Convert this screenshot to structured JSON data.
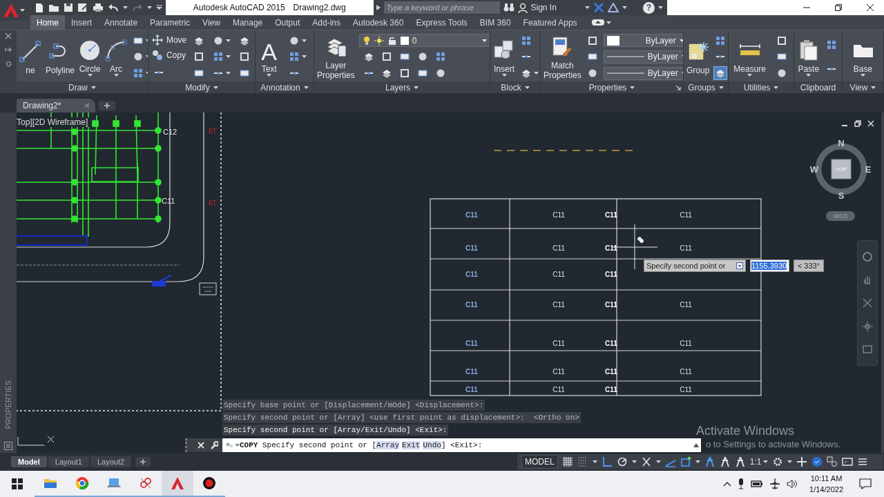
{
  "app": {
    "title": "Autodesk AutoCAD 2015",
    "file": "Drawing2.dwg"
  },
  "search": {
    "placeholder": "Type a keyword or phrase"
  },
  "account": {
    "label": "Sign In"
  },
  "help": {
    "label": "?"
  },
  "ribbon_tabs": [
    {
      "label": "Home",
      "selected": true
    },
    {
      "label": "Insert",
      "selected": false
    },
    {
      "label": "Annotate",
      "selected": false
    },
    {
      "label": "Parametric",
      "selected": false
    },
    {
      "label": "View",
      "selected": false
    },
    {
      "label": "Manage",
      "selected": false
    },
    {
      "label": "Output",
      "selected": false
    },
    {
      "label": "Add-ins",
      "selected": false
    },
    {
      "label": "Autodesk 360",
      "selected": false
    },
    {
      "label": "Express Tools",
      "selected": false
    },
    {
      "label": "BIM 360",
      "selected": false
    },
    {
      "label": "Featured Apps",
      "selected": false
    }
  ],
  "ribbon_panels": [
    {
      "title": "Draw",
      "menu": true,
      "launcher": false,
      "columns": [
        {
          "items": [
            {
              "kind": "large",
              "label": "ne",
              "dropdown": false
            }
          ]
        },
        {
          "items": [
            {
              "kind": "large",
              "label": "Polyline",
              "dropdown": false
            }
          ]
        },
        {
          "items": [
            {
              "kind": "large",
              "label": "Circle",
              "dropdown": true
            }
          ]
        },
        {
          "items": [
            {
              "kind": "large",
              "label": "Arc",
              "dropdown": true
            }
          ]
        },
        {
          "items": [
            {
              "kind": "icon",
              "dropdown": true
            },
            {
              "kind": "icon",
              "dropdown": true
            },
            {
              "kind": "icon",
              "dropdown": true
            }
          ]
        }
      ]
    },
    {
      "title": "Modify",
      "menu": true,
      "launcher": false,
      "columns": [
        {
          "items": [
            {
              "kind": "small",
              "label": "Move"
            },
            {
              "kind": "small",
              "label": "Copy"
            },
            {
              "kind": "icon",
              "dropdown": false
            }
          ]
        },
        {
          "items": [
            {
              "kind": "icon",
              "dropdown": false
            },
            {
              "kind": "icon",
              "dropdown": false
            },
            {
              "kind": "icon",
              "dropdown": false
            }
          ]
        },
        {
          "items": [
            {
              "kind": "icon",
              "dropdown": true
            },
            {
              "kind": "icon",
              "dropdown": true
            },
            {
              "kind": "icon",
              "dropdown": true
            }
          ]
        },
        {
          "items": [
            {
              "kind": "icon",
              "dropdown": false
            },
            {
              "kind": "icon",
              "dropdown": false
            },
            {
              "kind": "icon",
              "dropdown": false
            }
          ]
        }
      ]
    },
    {
      "title": "Annotation",
      "menu": true,
      "launcher": false,
      "columns": [
        {
          "items": [
            {
              "kind": "large",
              "label": "Text",
              "glyph": "A",
              "dropdown": true
            }
          ]
        },
        {
          "items": [
            {
              "kind": "icon",
              "dropdown": true
            },
            {
              "kind": "icon",
              "dropdown": true
            },
            {
              "kind": "icon",
              "dropdown": false
            }
          ]
        }
      ]
    },
    {
      "title": "Layers",
      "menu": true,
      "launcher": false,
      "columns": [
        {
          "items": [
            {
              "kind": "large",
              "label": "Layer Properties",
              "dropdown": false
            }
          ]
        },
        {
          "items": [
            {
              "kind": "layer_combo",
              "value": "0"
            },
            {
              "kind": "row",
              "items": [
                {
                  "kind": "icon",
                  "dropdown": false
                },
                {
                  "kind": "icon",
                  "dropdown": false
                },
                {
                  "kind": "icon",
                  "dropdown": false
                },
                {
                  "kind": "icon",
                  "dropdown": false
                },
                {
                  "kind": "icon",
                  "dropdown": false
                }
              ]
            },
            {
              "kind": "row",
              "items": [
                {
                  "kind": "icon",
                  "dropdown": false
                },
                {
                  "kind": "icon",
                  "dropdown": false
                },
                {
                  "kind": "icon",
                  "dropdown": false
                },
                {
                  "kind": "icon",
                  "dropdown": false
                },
                {
                  "kind": "icon",
                  "dropdown": false
                }
              ]
            }
          ]
        }
      ]
    },
    {
      "title": "Block",
      "menu": true,
      "launcher": false,
      "columns": [
        {
          "items": [
            {
              "kind": "large",
              "label": "Insert",
              "dropdown": true
            }
          ]
        },
        {
          "items": [
            {
              "kind": "icon",
              "dropdown": false
            },
            {
              "kind": "icon",
              "dropdown": false
            },
            {
              "kind": "icon",
              "dropdown": true
            }
          ]
        }
      ]
    },
    {
      "title": "Properties",
      "menu": true,
      "launcher": true,
      "columns": [
        {
          "items": [
            {
              "kind": "large",
              "label": "Match Properties",
              "dropdown": false
            }
          ]
        },
        {
          "items": [
            {
              "kind": "icon",
              "dropdown": false
            },
            {
              "kind": "icon",
              "dropdown": false
            },
            {
              "kind": "icon",
              "dropdown": false
            }
          ]
        },
        {
          "items": [
            {
              "kind": "color_combo",
              "value": "ByLayer"
            },
            {
              "kind": "line_combo",
              "value": "ByLayer"
            },
            {
              "kind": "line_combo",
              "value": "ByLayer"
            }
          ]
        }
      ]
    },
    {
      "title": "Groups",
      "menu": true,
      "launcher": false,
      "columns": [
        {
          "items": [
            {
              "kind": "large",
              "label": "Group",
              "dropdown": false
            }
          ]
        },
        {
          "items": [
            {
              "kind": "icon",
              "dropdown": false,
              "on": false
            },
            {
              "kind": "icon",
              "dropdown": false,
              "on": false
            },
            {
              "kind": "icon",
              "dropdown": false,
              "on": true
            }
          ]
        }
      ]
    },
    {
      "title": "Utilities",
      "menu": true,
      "launcher": false,
      "columns": [
        {
          "items": [
            {
              "kind": "large",
              "label": "Measure",
              "dropdown": true
            }
          ]
        },
        {
          "items": [
            {
              "kind": "icon",
              "dropdown": false
            },
            {
              "kind": "icon",
              "dropdown": false
            },
            {
              "kind": "icon",
              "dropdown": false
            }
          ]
        }
      ]
    },
    {
      "title": "Clipboard",
      "menu": false,
      "launcher": false,
      "columns": [
        {
          "items": [
            {
              "kind": "large",
              "label": "Paste",
              "dropdown": true
            }
          ]
        },
        {
          "items": [
            {
              "kind": "icon",
              "dropdown": false
            },
            {
              "kind": "icon",
              "dropdown": false
            }
          ]
        }
      ]
    },
    {
      "title": "View",
      "menu": true,
      "launcher": false,
      "columns": [
        {
          "items": [
            {
              "kind": "large",
              "label": "Base",
              "dropdown": true
            }
          ]
        }
      ]
    }
  ],
  "file_tabs": [
    {
      "label": "Drawing2*",
      "selected": true
    }
  ],
  "palette": {
    "title": "PROPERTIES"
  },
  "viewport": {
    "label": "Top][2D Wireframe]"
  },
  "viewcube": {
    "face": "TOP",
    "north": "N",
    "south": "S",
    "east": "E",
    "west": "W",
    "ucs": "WCS"
  },
  "drawing": {
    "labels": [
      "C12",
      "C11"
    ],
    "markers": [
      "5T",
      "6T"
    ]
  },
  "table": {
    "rows": [
      {
        "cells": [
          "C11",
          "C11",
          "C11",
          "C11"
        ]
      },
      {
        "cells": [
          "C11",
          "C11",
          "C11",
          "C11"
        ]
      },
      {
        "cells": [
          "C11",
          "C11",
          "C11"
        ]
      },
      {
        "cells": [
          "C11",
          "C11",
          "C11",
          "C11"
        ]
      },
      {
        "cells": [
          "C11",
          "C11",
          "C11",
          "C11"
        ]
      },
      {
        "cells": [
          "C11",
          "C11",
          "C11",
          "C11"
        ]
      },
      {
        "cells": [
          "C11",
          "C11",
          "C11",
          "C11"
        ]
      }
    ]
  },
  "dynamic_input": {
    "prompt": "Specify second point or",
    "distance": "1155.3930",
    "selected": true,
    "angle": "< 333°"
  },
  "command_history": [
    "Specify base point or [Displacement/mOde] <Displacement>:",
    "Specify second point or [Array] <use first point as displacement>:  <Ortho on>",
    "Specify second point or [Array/Exit/Undo] <Exit>:"
  ],
  "command_line": {
    "command": "COPY",
    "prompt": "Specify second point or [",
    "options": [
      "Array",
      "Exit",
      "Undo"
    ],
    "suffix": "] <Exit>:"
  },
  "activation_notice": {
    "title": "Activate Windows",
    "text": "o to Settings to activate Windows."
  },
  "layout_tabs": [
    {
      "label": "Model",
      "selected": true
    },
    {
      "label": "Layout1",
      "selected": false
    },
    {
      "label": "Layout2",
      "selected": false
    }
  ],
  "status_bar": {
    "mode": "MODEL",
    "scale": "1:1"
  },
  "taskbar": {
    "apps": [
      {
        "selected": false
      },
      {
        "selected": false
      },
      {
        "selected": false
      },
      {
        "selected": false
      },
      {
        "selected": true
      },
      {
        "selected": false
      }
    ],
    "time": "10:11 AM",
    "date": "1/14/2022"
  }
}
